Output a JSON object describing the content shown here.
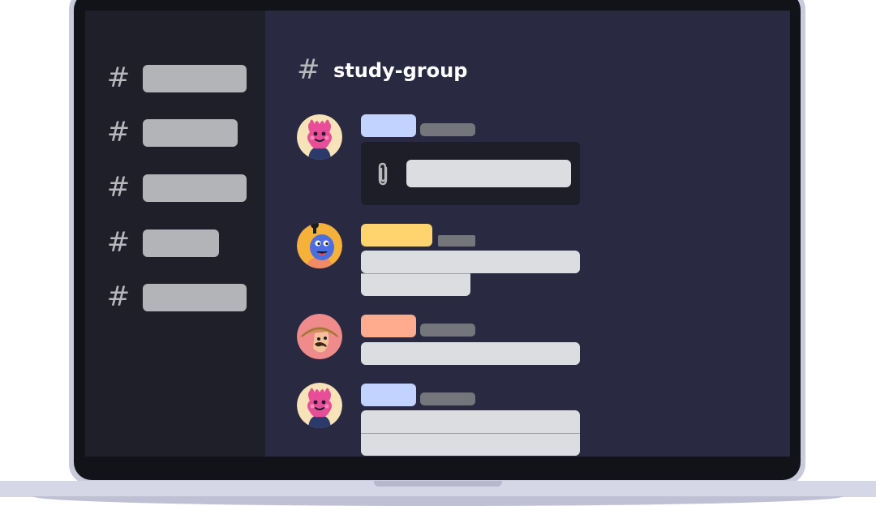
{
  "channel": {
    "title": "study-group",
    "hash_symbol": "#"
  },
  "sidebar": {
    "channels": [
      {
        "icon": "hash-icon"
      },
      {
        "icon": "hash-icon"
      },
      {
        "icon": "hash-icon"
      },
      {
        "icon": "hash-icon"
      },
      {
        "icon": "hash-icon"
      }
    ]
  },
  "messages": [
    {
      "author_color": "#c3d3ff",
      "attachment": true,
      "avatar": "pink-creature-avatar"
    },
    {
      "author_color": "#ffd36e",
      "lines": 2,
      "avatar": "blue-genie-avatar"
    },
    {
      "author_color": "#ffab8e",
      "lines": 1,
      "avatar": "mustache-explorer-avatar"
    },
    {
      "author_color": "#c3d3ff",
      "lines": 2,
      "avatar": "pink-creature-avatar"
    }
  ],
  "colors": {
    "sidebar_bg": "#1e1f29",
    "chat_bg": "#292a42",
    "placeholder": "#dcdde0"
  }
}
